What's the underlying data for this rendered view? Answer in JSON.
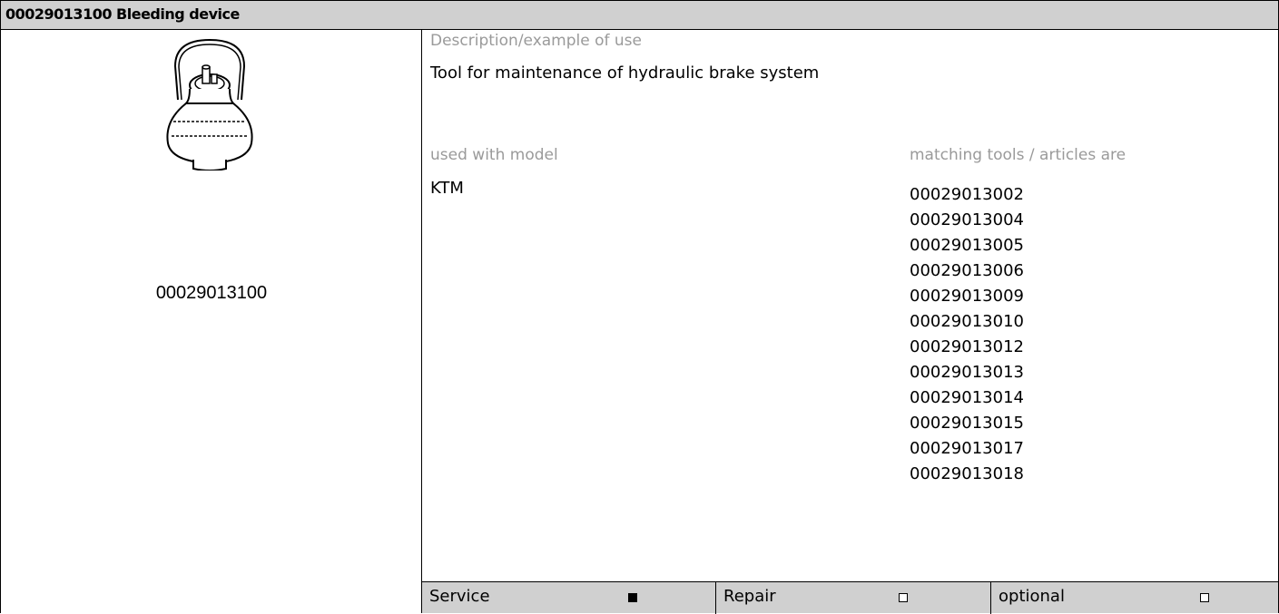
{
  "header": {
    "title": "00029013100 Bleeding device"
  },
  "tool": {
    "code": "00029013100",
    "icon": "bleeding-device-illustration"
  },
  "description": {
    "label": "Description/example of use",
    "text": "Tool for maintenance of hydraulic brake system"
  },
  "models": {
    "label": "used with model",
    "value": "KTM"
  },
  "matching": {
    "label": "matching tools / articles are",
    "items": [
      "00029013002",
      "00029013004",
      "00029013005",
      "00029013006",
      "00029013009",
      "00029013010",
      "00029013012",
      "00029013013",
      "00029013014",
      "00029013015",
      "00029013017",
      "00029013018"
    ]
  },
  "footer": {
    "service": {
      "label": "Service",
      "checked": true
    },
    "repair": {
      "label": "Repair",
      "checked": false
    },
    "optional": {
      "label": "optional",
      "checked": false
    }
  }
}
